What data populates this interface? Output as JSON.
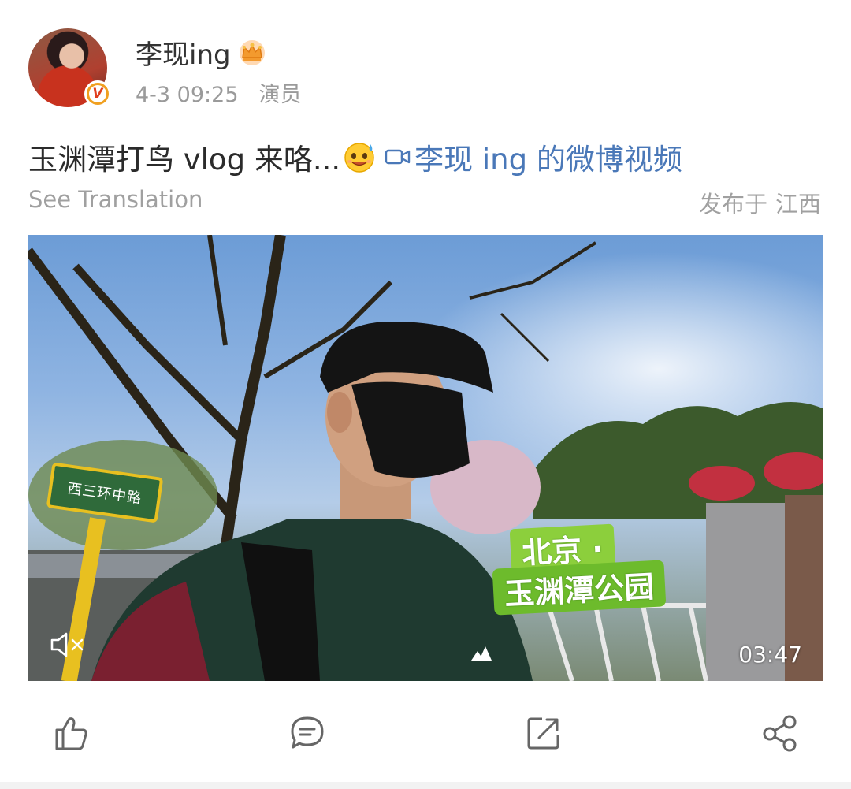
{
  "post": {
    "author": {
      "name": "李现ing",
      "verified_badge": "V",
      "crown_icon": "crown-icon",
      "avatar_icon": "avatar"
    },
    "time": "4-3 09:25",
    "role": "演员",
    "text": "玉渊潭打鸟 vlog 来咯...",
    "emoji_icon": "smiling-face-with-sweat-icon",
    "video_link": "李现 ing 的微博视频",
    "see_translation": "See Translation",
    "location_prefix": "发布于",
    "location": "江西"
  },
  "video": {
    "sign_text": "西三环中路",
    "overlay_line1": "北京 ·",
    "overlay_line2": "玉渊潭公园",
    "duration": "03:47",
    "mute_icon": "mute-icon"
  },
  "actions": [
    "like-icon",
    "comment-icon",
    "repost-icon",
    "share-icon"
  ],
  "colors": {
    "link": "#4a78b8",
    "secondary_text": "#9a9a9a",
    "badge": "#f0a020",
    "overlay_green": "#6dbb2c"
  }
}
